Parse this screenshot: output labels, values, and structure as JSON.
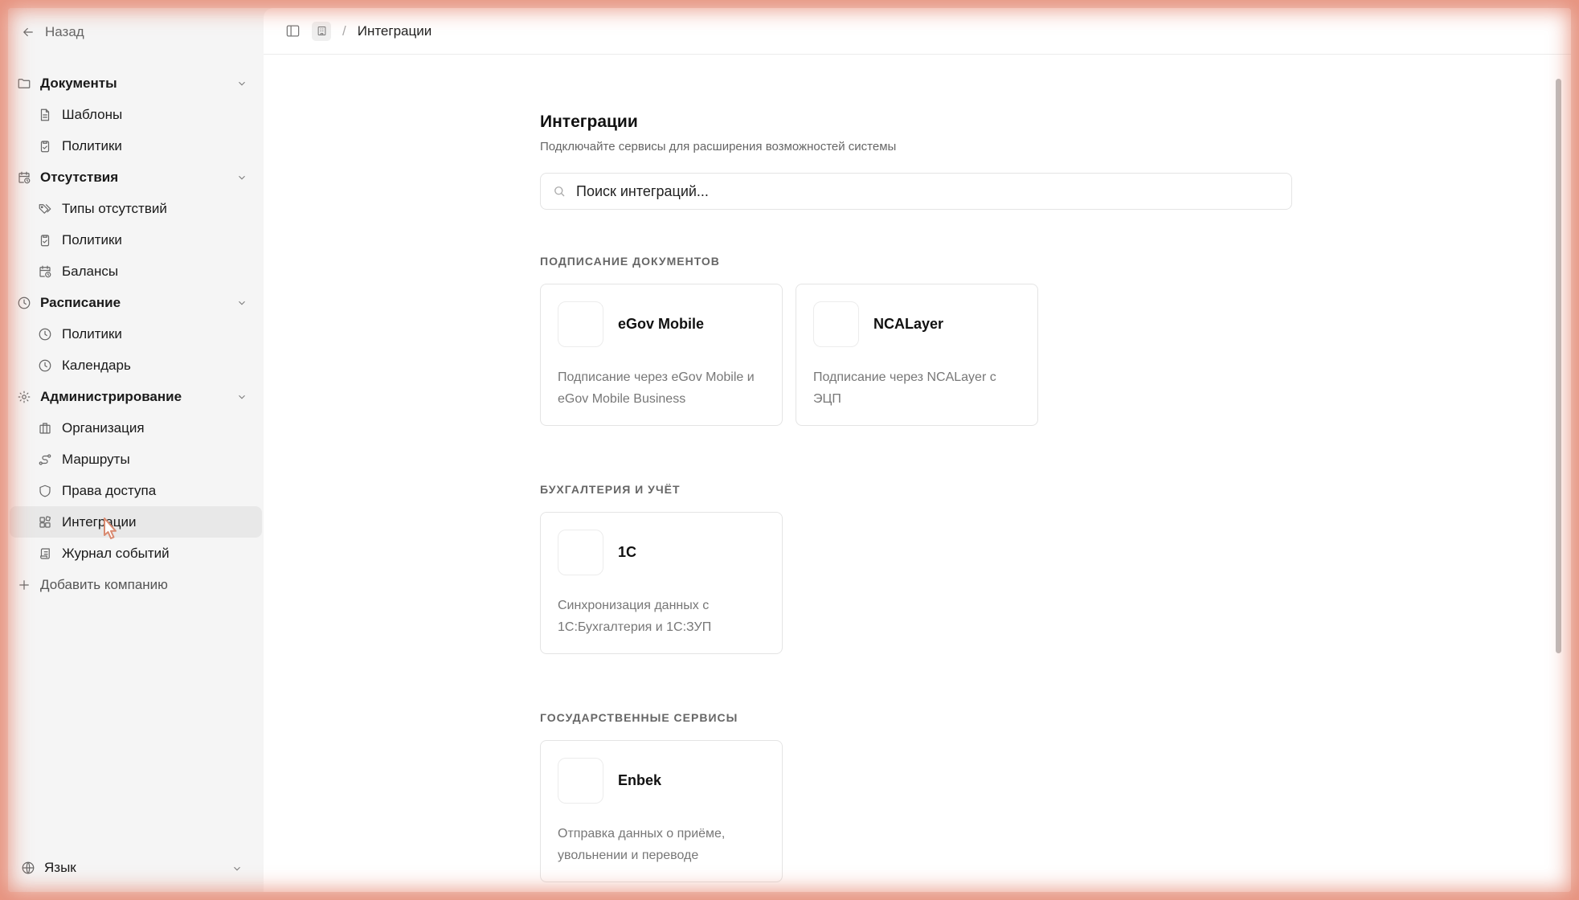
{
  "sidebar": {
    "back_label": "Назад",
    "groups": [
      {
        "label": "Документы",
        "icon": "folder-icon",
        "items": [
          {
            "label": "Шаблоны",
            "icon": "file-text-icon"
          },
          {
            "label": "Политики",
            "icon": "clipboard-check-icon"
          }
        ]
      },
      {
        "label": "Отсутствия",
        "icon": "calendar-clock-icon",
        "items": [
          {
            "label": "Типы отсутствий",
            "icon": "tags-icon"
          },
          {
            "label": "Политики",
            "icon": "clipboard-check-icon"
          },
          {
            "label": "Балансы",
            "icon": "calendar-clock-icon"
          }
        ]
      },
      {
        "label": "Расписание",
        "icon": "clock-icon",
        "items": [
          {
            "label": "Политики",
            "icon": "clock-icon"
          },
          {
            "label": "Календарь",
            "icon": "clock-icon"
          }
        ]
      },
      {
        "label": "Администрирование",
        "icon": "gear-icon",
        "items": [
          {
            "label": "Организация",
            "icon": "building-icon"
          },
          {
            "label": "Маршруты",
            "icon": "route-icon"
          },
          {
            "label": "Права доступа",
            "icon": "shield-icon"
          },
          {
            "label": "Интеграции",
            "icon": "blocks-icon",
            "active": true
          },
          {
            "label": "Журнал событий",
            "icon": "scroll-text-icon"
          }
        ]
      }
    ],
    "add_company_label": "Добавить компанию",
    "language_label": "Язык"
  },
  "topbar": {
    "breadcrumb": "Интеграции"
  },
  "main": {
    "title": "Интеграции",
    "subtitle": "Подключайте сервисы для расширения возможностей системы",
    "search_placeholder": "Поиск интеграций...",
    "sections": [
      {
        "title": "Подписание документов",
        "cards": [
          {
            "name": "eGov Mobile",
            "description": "Подписание через eGov Mobile и eGov Mobile Business"
          },
          {
            "name": "NCALayer",
            "description": "Подписание через NCALayer с ЭЦП"
          }
        ]
      },
      {
        "title": "Бухгалтерия и учёт",
        "cards": [
          {
            "name": "1С",
            "description": "Синхронизация данных с 1С:Бухгалтерия и 1С:ЗУП"
          }
        ]
      },
      {
        "title": "Государственные сервисы",
        "cards": [
          {
            "name": "Enbek",
            "description": "Отправка данных о приёме, увольнении и переводе"
          }
        ]
      }
    ]
  },
  "colors": {
    "accent_vignette": "#e27860",
    "active_bg": "#e8e8e8",
    "main_bg": "#ffffff",
    "sidebar_bg": "#f5f5f5"
  }
}
